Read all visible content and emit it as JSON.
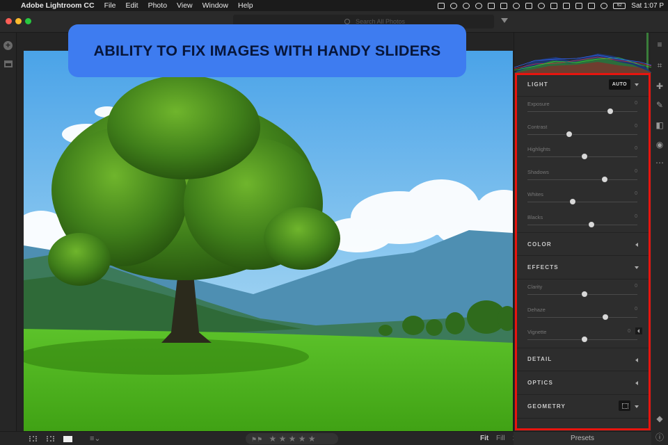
{
  "menubar": {
    "app_name": "Adobe Lightroom CC",
    "items": [
      "File",
      "Edit",
      "Photo",
      "View",
      "Window",
      "Help"
    ],
    "clock": "Sat 1:07 P",
    "battery": "62"
  },
  "search": {
    "placeholder": "Search All Photos"
  },
  "banner": {
    "text": "ABILITY TO FIX IMAGES WITH HANDY SLIDERS"
  },
  "panel": {
    "light": {
      "title": "LIGHT",
      "auto_label": "AUTO",
      "sliders": [
        {
          "label": "Exposure",
          "value": "0",
          "level": 0.75
        },
        {
          "label": "Contrast",
          "value": "0",
          "level": 0.38
        },
        {
          "label": "Highlights",
          "value": "0",
          "level": 0.52
        },
        {
          "label": "Shadows",
          "value": "0",
          "level": 0.7
        },
        {
          "label": "Whites",
          "value": "0",
          "level": 0.41
        },
        {
          "label": "Blacks",
          "value": "0",
          "level": 0.58
        }
      ]
    },
    "color": {
      "title": "COLOR"
    },
    "effects": {
      "title": "EFFECTS",
      "sliders": [
        {
          "label": "Clarity",
          "value": "0",
          "level": 0.52
        },
        {
          "label": "Dehaze",
          "value": "0",
          "level": 0.71
        },
        {
          "label": "Vignette",
          "value": "0",
          "level": 0.52
        }
      ]
    },
    "detail": {
      "title": "DETAIL"
    },
    "optics": {
      "title": "OPTICS"
    },
    "geometry": {
      "title": "GEOMETRY"
    }
  },
  "bottombar": {
    "stars": "★ ★ ★ ★ ★",
    "fit": "Fit",
    "fill": "Fill",
    "one": "1"
  },
  "presets": {
    "label": "Presets"
  },
  "colors": {
    "accent_banner": "#3e7cf0",
    "frame_red": "#e8140e"
  }
}
